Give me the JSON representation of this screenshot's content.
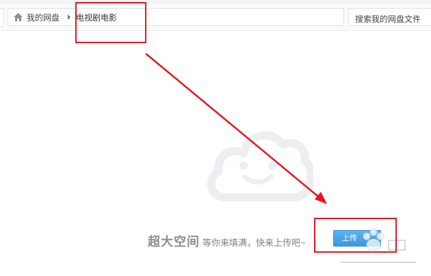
{
  "breadcrumb": {
    "home_icon": "home-icon",
    "home_label": "我的网盘",
    "current_folder": "电视剧电影"
  },
  "search": {
    "placeholder": "搜索我的网盘文件"
  },
  "empty_state": {
    "illustration": "smiling-cloud-icon",
    "title": "超大空间",
    "subtitle": "等你来填满，快来上传吧~",
    "upload_button_label": "上传"
  },
  "annotations": {
    "color": "#e8141b",
    "boxes": [
      "current-folder-highlight",
      "upload-button-highlight"
    ],
    "arrow": "arrow-to-upload"
  },
  "colors": {
    "accent_button": "#3c97dd",
    "annotation_red": "#e8141b"
  }
}
